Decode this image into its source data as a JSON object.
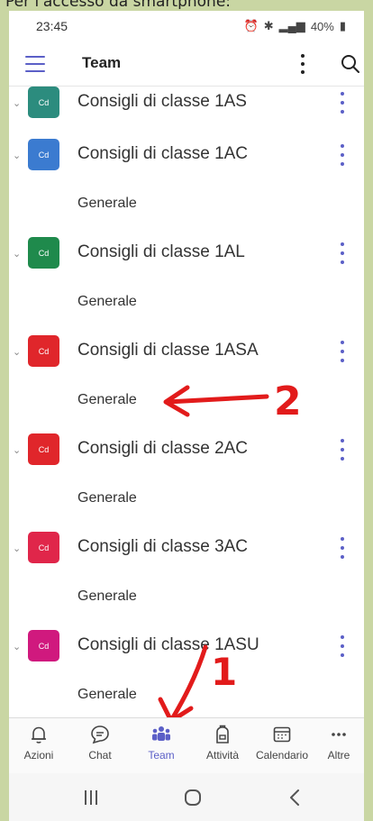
{
  "caption": "Per l'accesso da smartphone:",
  "status": {
    "time": "23:45",
    "battery": "40%"
  },
  "appbar": {
    "title": "Team"
  },
  "teams": [
    {
      "name": "Consigli di classe 1AS",
      "avatar": "Cd",
      "color": "#2c8c7e",
      "channel": ""
    },
    {
      "name": "Consigli di classe 1AC",
      "avatar": "Cd",
      "color": "#3b7bd0",
      "channel": "Generale"
    },
    {
      "name": "Consigli di classe 1AL",
      "avatar": "Cd",
      "color": "#1f8a4c",
      "channel": "Generale"
    },
    {
      "name": "Consigli di classe 1ASA",
      "avatar": "Cd",
      "color": "#e0262b",
      "channel": "Generale"
    },
    {
      "name": "Consigli di classe 2AC",
      "avatar": "Cd",
      "color": "#e0262b",
      "channel": "Generale"
    },
    {
      "name": "Consigli di classe 3AC",
      "avatar": "Cd",
      "color": "#e0264a",
      "channel": "Generale"
    },
    {
      "name": "Consigli di classe 1ASU",
      "avatar": "Cd",
      "color": "#d0197e",
      "channel": "Generale"
    }
  ],
  "annotations": {
    "arrow_channel": "2",
    "arrow_team_tab": "1"
  },
  "nav": [
    {
      "label": "Azioni",
      "icon": "bell-icon"
    },
    {
      "label": "Chat",
      "icon": "chat-icon"
    },
    {
      "label": "Team",
      "icon": "teams-icon",
      "active": true
    },
    {
      "label": "Attività",
      "icon": "backpack-icon"
    },
    {
      "label": "Calendario",
      "icon": "calendar-icon"
    },
    {
      "label": "Altre",
      "icon": "more-icon"
    }
  ],
  "colors": {
    "accent": "#5b5fc7",
    "annotation": "#e21b1b",
    "page_bg": "#c9d6a3"
  }
}
